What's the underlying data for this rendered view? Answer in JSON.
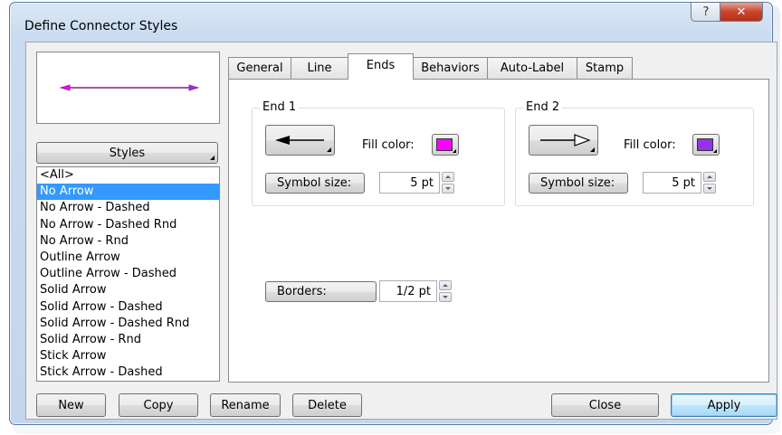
{
  "window": {
    "title": "Define Connector Styles",
    "help_label": "?",
    "close_label": "✕"
  },
  "styles_button": {
    "label": "Styles"
  },
  "styles_list": [
    "<All>",
    "No Arrow",
    "No Arrow - Dashed",
    "No Arrow - Dashed Rnd",
    "No Arrow - Rnd",
    "Outline Arrow",
    "Outline Arrow - Dashed",
    "Solid Arrow",
    "Solid Arrow - Dashed",
    "Solid Arrow - Dashed Rnd",
    "Solid Arrow - Rnd",
    "Stick Arrow",
    "Stick Arrow - Dashed"
  ],
  "selected_style": "No Arrow",
  "tabs": [
    "General",
    "Line",
    "Ends",
    "Behaviors",
    "Auto-Label",
    "Stamp"
  ],
  "active_tab": "Ends",
  "end1": {
    "label": "End 1",
    "fill_color_label": "Fill color:",
    "fill_color": "#ff00ff",
    "symbol_size_label": "Symbol size:",
    "symbol_size": "5 pt",
    "arrow": "solid-arrow-left"
  },
  "end2": {
    "label": "End 2",
    "fill_color_label": "Fill color:",
    "fill_color": "#9932e6",
    "symbol_size_label": "Symbol size:",
    "symbol_size": "5 pt",
    "arrow": "outline-arrow-right"
  },
  "borders": {
    "label": "Borders:",
    "value": "1/2 pt"
  },
  "preview": {
    "line_color": "#8b1a8b",
    "start_color": "#ff00ff",
    "end_color": "#9932e6"
  },
  "buttons": {
    "new": "New",
    "copy": "Copy",
    "rename": "Rename",
    "delete": "Delete",
    "close": "Close",
    "apply": "Apply"
  }
}
